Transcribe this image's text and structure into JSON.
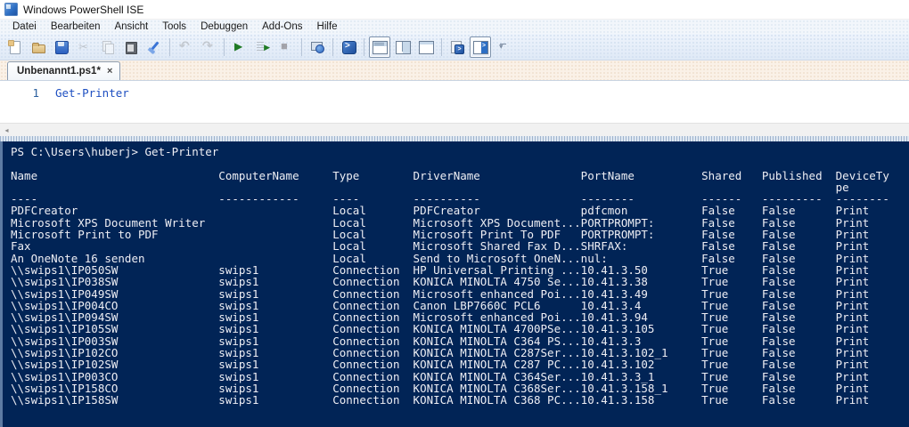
{
  "window": {
    "title": "Windows PowerShell ISE"
  },
  "menu": {
    "items": [
      "Datei",
      "Bearbeiten",
      "Ansicht",
      "Tools",
      "Debuggen",
      "Add-Ons",
      "Hilfe"
    ]
  },
  "toolbar": {
    "groups": [
      {
        "buttons": [
          {
            "name": "new-script-button",
            "icon": "new-script-icon"
          },
          {
            "name": "open-script-button",
            "icon": "open-script-icon"
          },
          {
            "name": "save-button",
            "icon": "save-icon"
          },
          {
            "name": "cut-button",
            "icon": "cut-icon",
            "disabled": true
          },
          {
            "name": "copy-button",
            "icon": "copy-icon",
            "disabled": true
          },
          {
            "name": "paste-button",
            "icon": "paste-icon"
          },
          {
            "name": "clear-console-button",
            "icon": "clear-console-icon"
          }
        ]
      },
      {
        "buttons": [
          {
            "name": "undo-button",
            "icon": "undo-icon",
            "disabled": true
          },
          {
            "name": "redo-button",
            "icon": "redo-icon",
            "disabled": true
          }
        ]
      },
      {
        "buttons": [
          {
            "name": "run-script-button",
            "icon": "run-script-icon"
          },
          {
            "name": "run-selection-button",
            "icon": "run-selection-icon"
          },
          {
            "name": "stop-button",
            "icon": "stop-icon",
            "disabled": true
          }
        ]
      },
      {
        "buttons": [
          {
            "name": "new-remote-powershell-tab-button",
            "icon": "new-remote-tab-icon"
          }
        ]
      },
      {
        "buttons": [
          {
            "name": "start-powershell-button",
            "icon": "powershell-icon"
          }
        ]
      },
      {
        "buttons": [
          {
            "name": "show-script-pane-top-button",
            "icon": "script-pane-top-icon",
            "selected": true
          },
          {
            "name": "show-script-pane-right-button",
            "icon": "script-pane-right-icon"
          },
          {
            "name": "show-script-pane-maximized-button",
            "icon": "script-pane-max-icon"
          }
        ]
      },
      {
        "buttons": [
          {
            "name": "powershell-tab-button",
            "icon": "powershell-tab-icon"
          },
          {
            "name": "show-command-addon-button",
            "icon": "command-addon-icon",
            "selected": true
          }
        ]
      }
    ]
  },
  "tab": {
    "label": "Unbenannt1.ps1*",
    "close_glyph": "×"
  },
  "editor": {
    "line_number": "1",
    "code": "Get-Printer"
  },
  "scrollbar": {
    "left_arrow": "◂"
  },
  "console": {
    "prompt": "PS C:\\Users\\huberj>",
    "command": "Get-Printer",
    "columns": [
      {
        "header": "Name",
        "underline": "----"
      },
      {
        "header": "ComputerName",
        "underline": "------------"
      },
      {
        "header": "Type",
        "underline": "----"
      },
      {
        "header": "DriverName",
        "underline": "----------"
      },
      {
        "header": "PortName",
        "underline": "--------"
      },
      {
        "header": "Shared",
        "underline": "------"
      },
      {
        "header": "Published",
        "underline": "---------"
      },
      {
        "header": "DeviceTy",
        "header2": "pe",
        "underline": "--------"
      }
    ],
    "rows": [
      [
        "PDFCreator",
        "",
        "Local",
        "PDFCreator",
        "pdfcmon",
        "False",
        "False",
        "Print"
      ],
      [
        "Microsoft XPS Document Writer",
        "",
        "Local",
        "Microsoft XPS Document...",
        "PORTPROMPT:",
        "False",
        "False",
        "Print"
      ],
      [
        "Microsoft Print to PDF",
        "",
        "Local",
        "Microsoft Print To PDF",
        "PORTPROMPT:",
        "False",
        "False",
        "Print"
      ],
      [
        "Fax",
        "",
        "Local",
        "Microsoft Shared Fax D...",
        "SHRFAX:",
        "False",
        "False",
        "Print"
      ],
      [
        "An OneNote 16 senden",
        "",
        "Local",
        "Send to Microsoft OneN...",
        "nul:",
        "False",
        "False",
        "Print"
      ],
      [
        "\\\\swips1\\IP050SW",
        "swips1",
        "Connection",
        "HP Universal Printing ...",
        "10.41.3.50",
        "True",
        "False",
        "Print"
      ],
      [
        "\\\\swips1\\IP038SW",
        "swips1",
        "Connection",
        "KONICA MINOLTA 4750 Se...",
        "10.41.3.38",
        "True",
        "False",
        "Print"
      ],
      [
        "\\\\swips1\\IP049SW",
        "swips1",
        "Connection",
        "Microsoft enhanced Poi...",
        "10.41.3.49",
        "True",
        "False",
        "Print"
      ],
      [
        "\\\\swips1\\IP004CO",
        "swips1",
        "Connection",
        "Canon LBP7660C PCL6",
        "10.41.3.4",
        "True",
        "False",
        "Print"
      ],
      [
        "\\\\swips1\\IP094SW",
        "swips1",
        "Connection",
        "Microsoft enhanced Poi...",
        "10.41.3.94",
        "True",
        "False",
        "Print"
      ],
      [
        "\\\\swips1\\IP105SW",
        "swips1",
        "Connection",
        "KONICA MINOLTA 4700PSe...",
        "10.41.3.105",
        "True",
        "False",
        "Print"
      ],
      [
        "\\\\swips1\\IP003SW",
        "swips1",
        "Connection",
        "KONICA MINOLTA C364 PS...",
        "10.41.3.3",
        "True",
        "False",
        "Print"
      ],
      [
        "\\\\swips1\\IP102CO",
        "swips1",
        "Connection",
        "KONICA MINOLTA C287Ser...",
        "10.41.3.102_1",
        "True",
        "False",
        "Print"
      ],
      [
        "\\\\swips1\\IP102SW",
        "swips1",
        "Connection",
        "KONICA MINOLTA C287 PC...",
        "10.41.3.102",
        "True",
        "False",
        "Print"
      ],
      [
        "\\\\swips1\\IP003CO",
        "swips1",
        "Connection",
        "KONICA MINOLTA C364Ser...",
        "10.41.3.3_1",
        "True",
        "False",
        "Print"
      ],
      [
        "\\\\swips1\\IP158CO",
        "swips1",
        "Connection",
        "KONICA MINOLTA C368Ser...",
        "10.41.3.158_1",
        "True",
        "False",
        "Print"
      ],
      [
        "\\\\swips1\\IP158SW",
        "swips1",
        "Connection",
        "KONICA MINOLTA C368 PC...",
        "10.41.3.158",
        "True",
        "False",
        "Print"
      ]
    ]
  },
  "colors": {
    "console_bg": "#012456",
    "console_text": "#eeeef4",
    "accent_blue": "#2d6fc4"
  }
}
